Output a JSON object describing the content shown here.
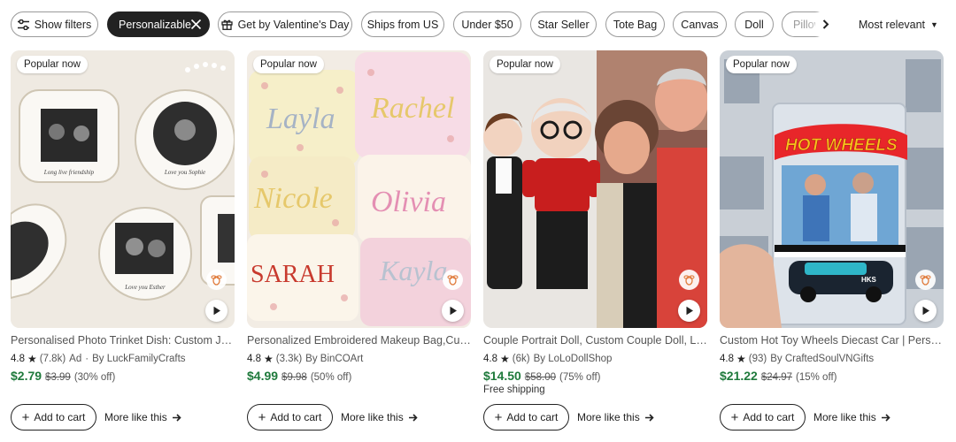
{
  "filters": {
    "show_filters": "Show filters",
    "personalizable": "Personalizable",
    "valentines": "Get by Valentine's Day",
    "ships_us": "Ships from US",
    "under_50": "Under $50",
    "star_seller": "Star Seller",
    "tote_bag": "Tote Bag",
    "canvas": "Canvas",
    "doll": "Doll",
    "pillow": "Pillow"
  },
  "sort": {
    "label": "Most relevant"
  },
  "products": [
    {
      "badge": "Popular now",
      "title": "Personalised Photo Trinket Dish: Custom Jewellery Dish",
      "rating": "4.8",
      "reviews": "(7.8k)",
      "ad": "Ad",
      "shop": "By LuckFamilyCrafts",
      "price": "$2.79",
      "original_price": "$3.99",
      "discount": "(30% off)",
      "shipping": "",
      "add_to_cart": "Add to cart",
      "more_like_this": "More like this",
      "image_texts": [
        "Long live friendship",
        "Love you Sophie",
        "Love you Esther"
      ]
    },
    {
      "badge": "Popular now",
      "title": "Personalized Embroidered Makeup Bag,Custom Cosmetic Bag",
      "rating": "4.8",
      "reviews": "(3.3k)",
      "ad": "",
      "shop": "By BinCOArt",
      "price": "$4.99",
      "original_price": "$9.98",
      "discount": "(50% off)",
      "shipping": "",
      "add_to_cart": "Add to cart",
      "more_like_this": "More like this",
      "image_texts": [
        "Layla",
        "Rachel",
        "Nicole",
        "Olivia",
        "SARAH",
        "Kayla"
      ]
    },
    {
      "badge": "Popular now",
      "title": "Couple Portrait Doll, Custom Couple Doll, Look Alike Doll",
      "rating": "4.8",
      "reviews": "(6k)",
      "ad": "",
      "shop": "By LoLoDollShop",
      "price": "$14.50",
      "original_price": "$58.00",
      "discount": "(75% off)",
      "shipping": "Free shipping",
      "add_to_cart": "Add to cart",
      "more_like_this": "More like this",
      "image_texts": []
    },
    {
      "badge": "Popular now",
      "title": "Custom Hot Toy Wheels Diecast Car | Personalized Gift",
      "rating": "4.8",
      "reviews": "(93)",
      "ad": "",
      "shop": "By CraftedSoulVNGifts",
      "price": "$21.22",
      "original_price": "$24.97",
      "discount": "(15% off)",
      "shipping": "",
      "add_to_cart": "Add to cart",
      "more_like_this": "More like this",
      "image_texts": [
        "HOT WHEELS",
        "HKS"
      ]
    }
  ],
  "colors": {
    "price_green": "#1f7a3c",
    "active_chip": "#222222",
    "hot_wheels_red": "#e8262a",
    "hot_wheels_yellow": "#f6c21b"
  }
}
